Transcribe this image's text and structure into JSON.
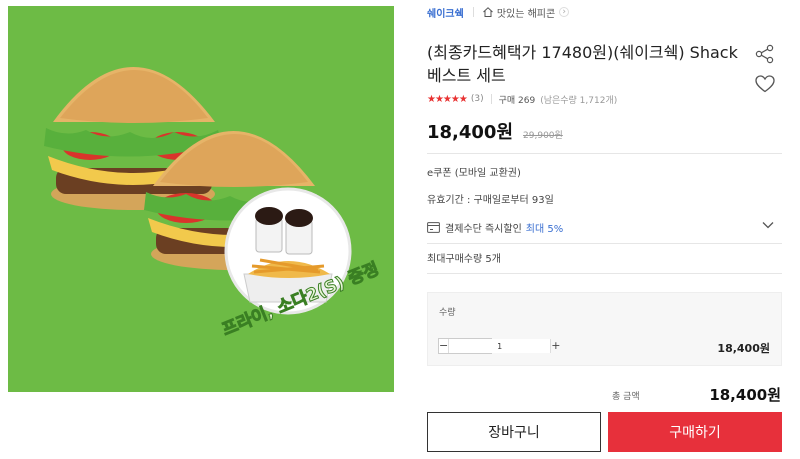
{
  "header": {
    "brand": "쉐이크쉑",
    "store": "맛있는 해피콘",
    "store_chevron": "›"
  },
  "product": {
    "title": "(최종카드혜택가 17480원)(쉐이크쉑) Shack 베스트 세트",
    "image_caption": "프라이, 소다2(S) 증정",
    "stars": "★★★★★",
    "review_count": "(3)",
    "purchase_count": "구매 269",
    "remaining": "(남은수량 1,712개)",
    "price": "18,400원",
    "original_price": "29,900원"
  },
  "info": {
    "coupon_type": "e쿠폰 (모바일 교환권)",
    "validity": "유효기간 : 구매일로부터 93일",
    "discount_label": "결제수단 즉시할인",
    "discount_value": "최대 5%",
    "max_quantity": "최대구매수량 5개"
  },
  "quantity": {
    "label": "수량",
    "minus": "−",
    "plus": "+",
    "value": "1",
    "line_price": "18,400원"
  },
  "total": {
    "label": "총 금액",
    "price": "18,400원"
  },
  "buttons": {
    "cart": "장바구니",
    "buy": "구매하기"
  },
  "colors": {
    "accent_red": "#e7303b",
    "link_blue": "#3a6fd1",
    "image_background": "#6dbb45"
  },
  "icons": {
    "store": "house-icon",
    "share": "share-icon",
    "wishlist": "heart-icon",
    "payment": "credit-card-icon",
    "expand": "chevron-down-icon"
  }
}
